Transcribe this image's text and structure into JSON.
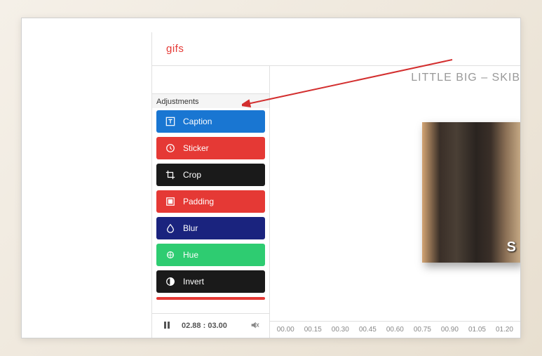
{
  "header": {
    "title": "gifs"
  },
  "tabs": [
    "caption-tab",
    "timer-tab",
    "effects-tab",
    "adjustments-tab"
  ],
  "section_label": "Adjustments",
  "adjustments": [
    {
      "key": "caption",
      "label": "Caption"
    },
    {
      "key": "sticker",
      "label": "Sticker"
    },
    {
      "key": "crop",
      "label": "Crop"
    },
    {
      "key": "padding",
      "label": "Padding"
    },
    {
      "key": "blur",
      "label": "Blur"
    },
    {
      "key": "hue",
      "label": "Hue"
    },
    {
      "key": "invert",
      "label": "Invert"
    }
  ],
  "playback": {
    "current": "02.88",
    "total": "03.00"
  },
  "preview": {
    "title": "LITTLE BIG – SKIB",
    "caption_overlay": "S"
  },
  "timeline_ticks": [
    "00.00",
    "00.15",
    "00.30",
    "00.45",
    "00.60",
    "00.75",
    "00.90",
    "01.05",
    "01.20"
  ]
}
